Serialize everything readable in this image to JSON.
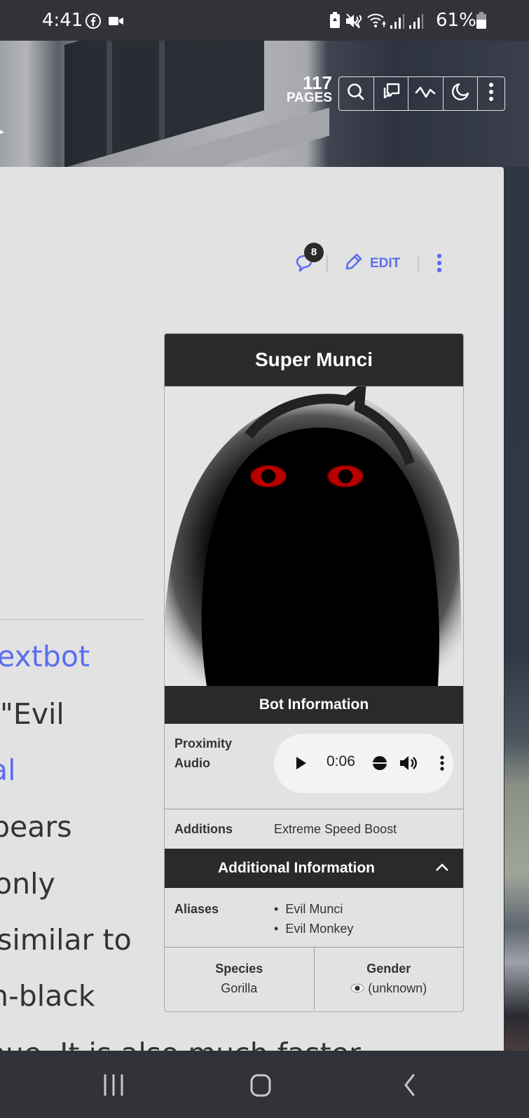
{
  "status_bar": {
    "time": "4:41",
    "notification_icons": [
      "facebook-icon",
      "video-camera-icon"
    ],
    "system_icons": [
      "battery-saver-icon",
      "vibrate-mute-icon",
      "wifi-icon",
      "signal-icon",
      "signal-icon"
    ],
    "battery": "61%"
  },
  "wiki_header": {
    "pages_count": "117",
    "pages_label": "PAGES",
    "tools": [
      "search-icon",
      "discussions-icon",
      "activity-icon",
      "dark-mode-icon",
      "more-vertical-icon"
    ]
  },
  "page_actions": {
    "comments_count": "8",
    "edit_label": "EDIT"
  },
  "article_fragments": [
    {
      "text": "extbot",
      "link": true
    },
    {
      "text": " \"Evil",
      "link": false
    },
    {
      "text": "al",
      "link": true
    },
    {
      "text": "pears",
      "link": false
    },
    {
      "text": "only",
      "link": false
    },
    {
      "text": "similar to",
      "link": false
    },
    {
      "text": "n-black",
      "link": false
    },
    {
      "text": "hue. It is also much faster",
      "link": false
    }
  ],
  "infobox": {
    "title": "Super Munci",
    "image_alt": "Super Munci dark silhouette with red eyes",
    "bot_info_header": "Bot Information",
    "proximity_audio_label": "Proximity Audio",
    "audio": {
      "time": "0:06",
      "state": "paused"
    },
    "additions_label": "Additions",
    "additions_value": "Extreme Speed Boost",
    "additional_info_header": "Additional Information",
    "aliases_label": "Aliases",
    "aliases": [
      "Evil Munci",
      "Evil Monkey"
    ],
    "species_label": "Species",
    "species_value": "Gorilla",
    "gender_label": "Gender",
    "gender_value": "(unknown)"
  },
  "colors": {
    "accent": "#5b6ef0",
    "infobox_header": "#2a2a2a",
    "card_bg": "#e2e2e2"
  }
}
